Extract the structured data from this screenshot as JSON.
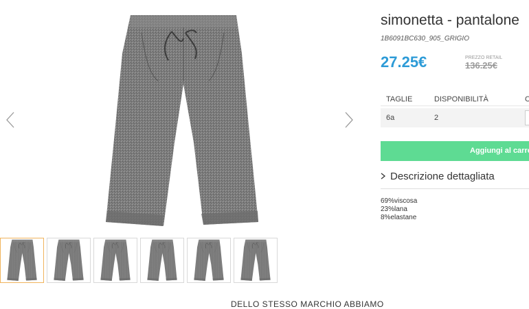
{
  "product": {
    "title": "simonetta - pantalone",
    "sku": "1B6091BC630_905_GRIGIO",
    "price": "27.25€",
    "retail_label": "PREZZO RETAIL",
    "retail_price": "136.25€",
    "accent_color": "#2d9bd7",
    "cart_color": "#5edb93"
  },
  "table": {
    "headers": [
      "TAGLIE",
      "DISPONIBILITÀ",
      "C"
    ],
    "rows": [
      {
        "size": "6a",
        "availability": "2"
      }
    ]
  },
  "cart_button_label": "Aggiungi al carrello",
  "description": {
    "toggle_label": "Descrizione dettagliata",
    "composition": [
      "69%viscosa",
      "23%lana",
      "8%elastane"
    ]
  },
  "gallery": {
    "icons": [
      "chevron-left-icon",
      "chevron-right-icon"
    ],
    "thumbnail_count": 6,
    "active_thumbnail": 1
  },
  "footer_heading": "DELLO STESSO MARCHIO ABBIAMO"
}
